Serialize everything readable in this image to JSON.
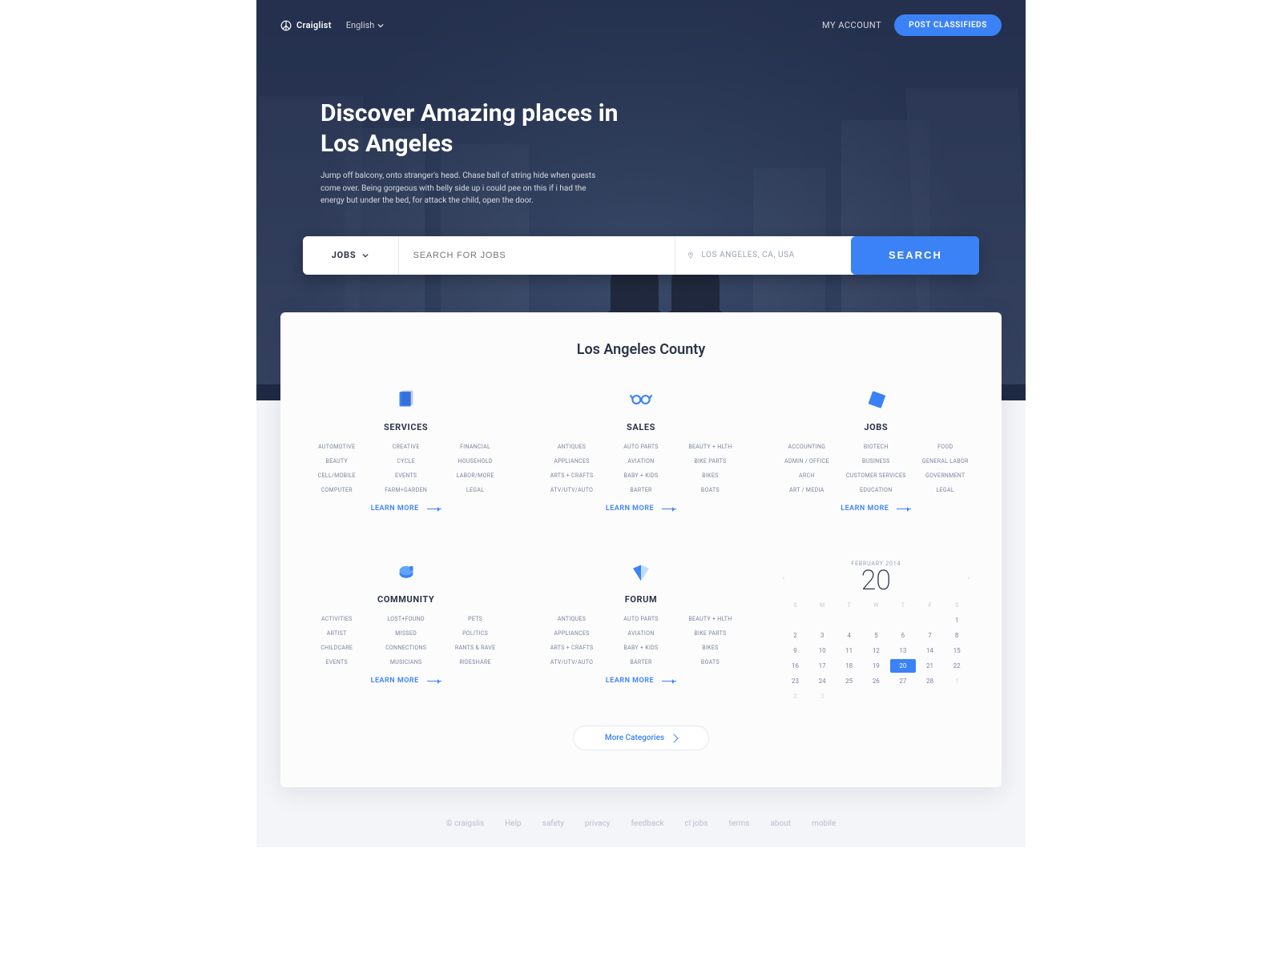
{
  "header": {
    "brand": "Craiglist",
    "language": "English",
    "my_account": "MY ACCOUNT",
    "post_btn": "POST CLASSIFIEDS"
  },
  "hero": {
    "title": "Discover Amazing places in Los Angeles",
    "subtitle": "Jump off balcony, onto stranger's head. Chase ball of string hide when guests come over. Being gorgeous with belly side up i could pee on this if i had the energy but under the bed, for attack the child, open the door."
  },
  "search": {
    "category": "JOBS",
    "query_placeholder": "SEARCH FOR JOBS",
    "location": "LOS ANGELES, CA, USA",
    "button": "SEARCH"
  },
  "county": {
    "title": "Los Angeles County",
    "learn_more": "LEARN MORE",
    "more_categories": "More Categories",
    "blocks": [
      {
        "id": "services",
        "title": "SERVICES",
        "links": [
          "AUTOMOTIVE",
          "CREATIVE",
          "FINANCIAL",
          "BEAUTY",
          "CYCLE",
          "HOUSEHOLD",
          "CELL/MOBILE",
          "EVENTS",
          "LABOR/MORE",
          "COMPUTER",
          "FARM+GARDEN",
          "LEGAL"
        ]
      },
      {
        "id": "sales",
        "title": "SALES",
        "links": [
          "ANTIQUES",
          "AUTO PARTS",
          "BEAUTY + HLTH",
          "APPLIANCES",
          "AVIATION",
          "BIKE PARTS",
          "ARTS + CRAFTS",
          "BABY + KIDS",
          "BIKES",
          "ATV/UTV/AUTO",
          "BARTER",
          "BOATS"
        ]
      },
      {
        "id": "jobs",
        "title": "JOBS",
        "links": [
          "ACCOUNTING",
          "BIOTECH",
          "FOOD",
          "ADMIN / OFFICE",
          "BUSINESS",
          "GENERAL LABOR",
          "ARCH",
          "CUSTOMER SERVICES",
          "GOVERNMENT",
          "ART / MEDIA",
          "EDUCATION",
          "LEGAL"
        ]
      },
      {
        "id": "community",
        "title": "COMMUNITY",
        "links": [
          "ACTIVITIES",
          "LOST+FOUND",
          "PETS",
          "ARTIST",
          "MISSED",
          "POLITICS",
          "CHILDCARE",
          "CONNECTIONS",
          "RANTS & RAVE",
          "EVENTS",
          "MUSICIANS",
          "RIDESHARE"
        ]
      },
      {
        "id": "forum",
        "title": "FORUM",
        "links": [
          "ANTIQUES",
          "AUTO PARTS",
          "BEAUTY + HLTH",
          "APPLIANCES",
          "AVIATION",
          "BIKE PARTS",
          "ARTS + CRAFTS",
          "BABY + KIDS",
          "BIKES",
          "ATV/UTV/AUTO",
          "BARTER",
          "BOATS"
        ]
      }
    ]
  },
  "calendar": {
    "month_label": "FEBRUARY 2014",
    "big_day": "20",
    "day_initials": [
      "S",
      "M",
      "T",
      "W",
      "T",
      "F",
      "S"
    ],
    "leading_blank": 6,
    "days_in_month": 28,
    "trailing_days": [
      1,
      2,
      3
    ],
    "selected": 20
  },
  "footer": {
    "copyright": "© craigslis",
    "links": [
      "Help",
      "safety",
      "privacy",
      "feedback",
      "cl jobs",
      "terms",
      "about",
      "mobile"
    ]
  },
  "colors": {
    "accent": "#3b82f6",
    "dark": "#1e2a44"
  }
}
